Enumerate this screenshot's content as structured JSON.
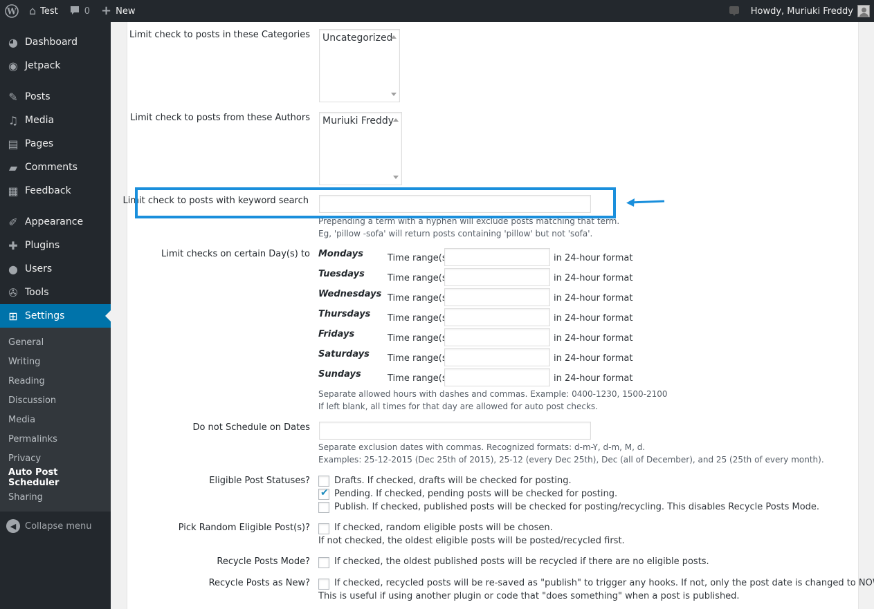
{
  "adminbar": {
    "site_name": "Test",
    "comments_count": "0",
    "new_label": "New",
    "greeting": "Howdy, Muriuki Freddy"
  },
  "sidebar": {
    "items": [
      {
        "label": "Dashboard",
        "icon": "dashboard-icon"
      },
      {
        "label": "Jetpack",
        "icon": "jetpack-icon"
      },
      {
        "label": "Posts",
        "icon": "pin-icon"
      },
      {
        "label": "Media",
        "icon": "media-icon"
      },
      {
        "label": "Pages",
        "icon": "pages-icon"
      },
      {
        "label": "Comments",
        "icon": "comments-icon"
      },
      {
        "label": "Feedback",
        "icon": "feedback-icon"
      },
      {
        "label": "Appearance",
        "icon": "brush-icon"
      },
      {
        "label": "Plugins",
        "icon": "plugin-icon"
      },
      {
        "label": "Users",
        "icon": "users-icon"
      },
      {
        "label": "Tools",
        "icon": "wrench-icon"
      },
      {
        "label": "Settings",
        "icon": "settings-icon"
      }
    ],
    "submenu": [
      "General",
      "Writing",
      "Reading",
      "Discussion",
      "Media",
      "Permalinks",
      "Privacy",
      "Auto Post Scheduler",
      "Sharing"
    ],
    "collapse_label": "Collapse menu"
  },
  "form": {
    "categories_label": "Limit check to posts in these Categories",
    "categories_option": "Uncategorized",
    "authors_label": "Limit check to posts from these Authors",
    "authors_option": "Muriuki Freddy",
    "keyword_label": "Limit check to posts with keyword search",
    "keyword_value": "",
    "keyword_desc1": "Prepending a term with a hyphen will exclude posts matching that term.",
    "keyword_desc2": "Eg, 'pillow -sofa' will return posts containing 'pillow' but not 'sofa'.",
    "days_label": "Limit checks on certain Day(s) to",
    "days": [
      "Mondays",
      "Tuesdays",
      "Wednesdays",
      "Thursdays",
      "Fridays",
      "Saturdays",
      "Sundays"
    ],
    "time_range_label": "Time range(s)",
    "time_format_label": "in 24-hour format",
    "days_desc1": "Separate allowed hours with dashes and commas. Example: 0400-1230, 1500-2100",
    "days_desc2": "If left blank, all times for that day are allowed for auto post checks.",
    "dates_label": "Do not Schedule on Dates",
    "dates_desc1": "Separate exclusion dates with commas. Recognized formats: d-m-Y, d-m, M, d.",
    "dates_desc2": "Examples: 25-12-2015 (Dec 25th of 2015), 25-12 (every Dec 25th), Dec (all of December), and 25 (25th of every month).",
    "statuses_label": "Eligible Post Statuses?",
    "status_drafts": "Drafts. If checked, drafts will be checked for posting.",
    "status_pending": "Pending. If checked, pending posts will be checked for posting.",
    "status_publish": "Publish. If checked, published posts will be checked for posting/recycling. This disables Recycle Posts Mode.",
    "random_label": "Pick Random Eligible Post(s)?",
    "random_cb": "If checked, random eligible posts will be chosen.",
    "random_desc": "If not checked, the oldest eligible posts will be posted/recycled first.",
    "recycle_label": "Recycle Posts Mode?",
    "recycle_cb": "If checked, the oldest published posts will be recycled if there are no eligible posts.",
    "recycle_new_label": "Recycle Posts as New?",
    "recycle_new_cb": "If checked, recycled posts will be re-saved as \"publish\" to trigger any hooks. If not, only the post date is changed to NOW.",
    "recycle_new_desc": "This is useful if using another plugin or code that \"does something\" when a post is published."
  },
  "colors": {
    "highlight": "#1a8fdc",
    "menu_current": "#0073aa"
  }
}
